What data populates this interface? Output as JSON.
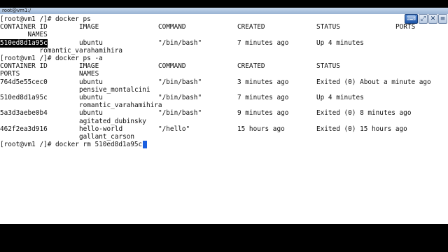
{
  "window": {
    "title": "root@vm1:/",
    "buttons": [
      {
        "name": "keyboard-icon",
        "glyph": "⌨"
      },
      {
        "name": "fullscreen-icon",
        "glyph": "⤢"
      },
      {
        "name": "close-icon",
        "glyph": "✕"
      },
      {
        "name": "menu-icon",
        "glyph": "≡"
      }
    ]
  },
  "terminal": {
    "lines": [
      {
        "segments": [
          {
            "text": "[root@vm1 /]# docker ps",
            "col": 0
          }
        ]
      },
      {
        "segments": [
          {
            "text": "CONTAINER ID",
            "col": 0
          },
          {
            "text": "IMAGE",
            "col": 20
          },
          {
            "text": "COMMAND",
            "col": 40
          },
          {
            "text": "CREATED",
            "col": 60
          },
          {
            "text": "STATUS",
            "col": 80
          },
          {
            "text": "PORTS",
            "col": 100
          }
        ]
      },
      {
        "segments": [
          {
            "text": "NAMES",
            "col": 7
          }
        ]
      },
      {
        "segments": [
          {
            "text": "510ed8d1a95c",
            "col": 0,
            "highlight": true
          },
          {
            "text": "ubuntu",
            "col": 20
          },
          {
            "text": "\"/bin/bash\"",
            "col": 40
          },
          {
            "text": "7 minutes ago",
            "col": 60
          },
          {
            "text": "Up 4 minutes",
            "col": 80
          }
        ]
      },
      {
        "segments": [
          {
            "text": "romantic_varahamihira",
            "col": 10
          }
        ]
      },
      {
        "segments": [
          {
            "text": "[root@vm1 /]# docker ps -a",
            "col": 0
          }
        ]
      },
      {
        "segments": [
          {
            "text": "CONTAINER ID",
            "col": 0
          },
          {
            "text": "IMAGE",
            "col": 20
          },
          {
            "text": "COMMAND",
            "col": 40
          },
          {
            "text": "CREATED",
            "col": 60
          },
          {
            "text": "STATUS",
            "col": 80
          }
        ]
      },
      {
        "segments": [
          {
            "text": "PORTS",
            "col": 0
          },
          {
            "text": "NAMES",
            "col": 20
          }
        ]
      },
      {
        "segments": [
          {
            "text": "764d5e55cec0",
            "col": 0
          },
          {
            "text": "ubuntu",
            "col": 20
          },
          {
            "text": "\"/bin/bash\"",
            "col": 40
          },
          {
            "text": "3 minutes ago",
            "col": 60
          },
          {
            "text": "Exited (0) About a minute ago",
            "col": 80
          }
        ]
      },
      {
        "segments": [
          {
            "text": "pensive_montalcini",
            "col": 20
          }
        ]
      },
      {
        "segments": [
          {
            "text": "510ed8d1a95c",
            "col": 0
          },
          {
            "text": "ubuntu",
            "col": 20
          },
          {
            "text": "\"/bin/bash\"",
            "col": 40
          },
          {
            "text": "7 minutes ago",
            "col": 60
          },
          {
            "text": "Up 4 minutes",
            "col": 80
          }
        ]
      },
      {
        "segments": [
          {
            "text": "romantic_varahamihira",
            "col": 20
          }
        ]
      },
      {
        "segments": [
          {
            "text": "5a3d3aebe0b4",
            "col": 0
          },
          {
            "text": "ubuntu",
            "col": 20
          },
          {
            "text": "\"/bin/bash\"",
            "col": 40
          },
          {
            "text": "9 minutes ago",
            "col": 60
          },
          {
            "text": "Exited (0) 8 minutes ago",
            "col": 80
          }
        ]
      },
      {
        "segments": [
          {
            "text": "agitated_dubinsky",
            "col": 20
          }
        ]
      },
      {
        "segments": [
          {
            "text": "462f2ea3d916",
            "col": 0
          },
          {
            "text": "hello-world",
            "col": 20
          },
          {
            "text": "\"/hello\"",
            "col": 40
          },
          {
            "text": "15 hours ago",
            "col": 60
          },
          {
            "text": "Exited (0) 15 hours ago",
            "col": 80
          }
        ]
      },
      {
        "segments": [
          {
            "text": "gallant_carson",
            "col": 20
          }
        ]
      },
      {
        "segments": [
          {
            "text": "[root@vm1 /]# docker rm 510ed8d1a95c",
            "col": 0
          }
        ],
        "cursor": true
      }
    ]
  }
}
